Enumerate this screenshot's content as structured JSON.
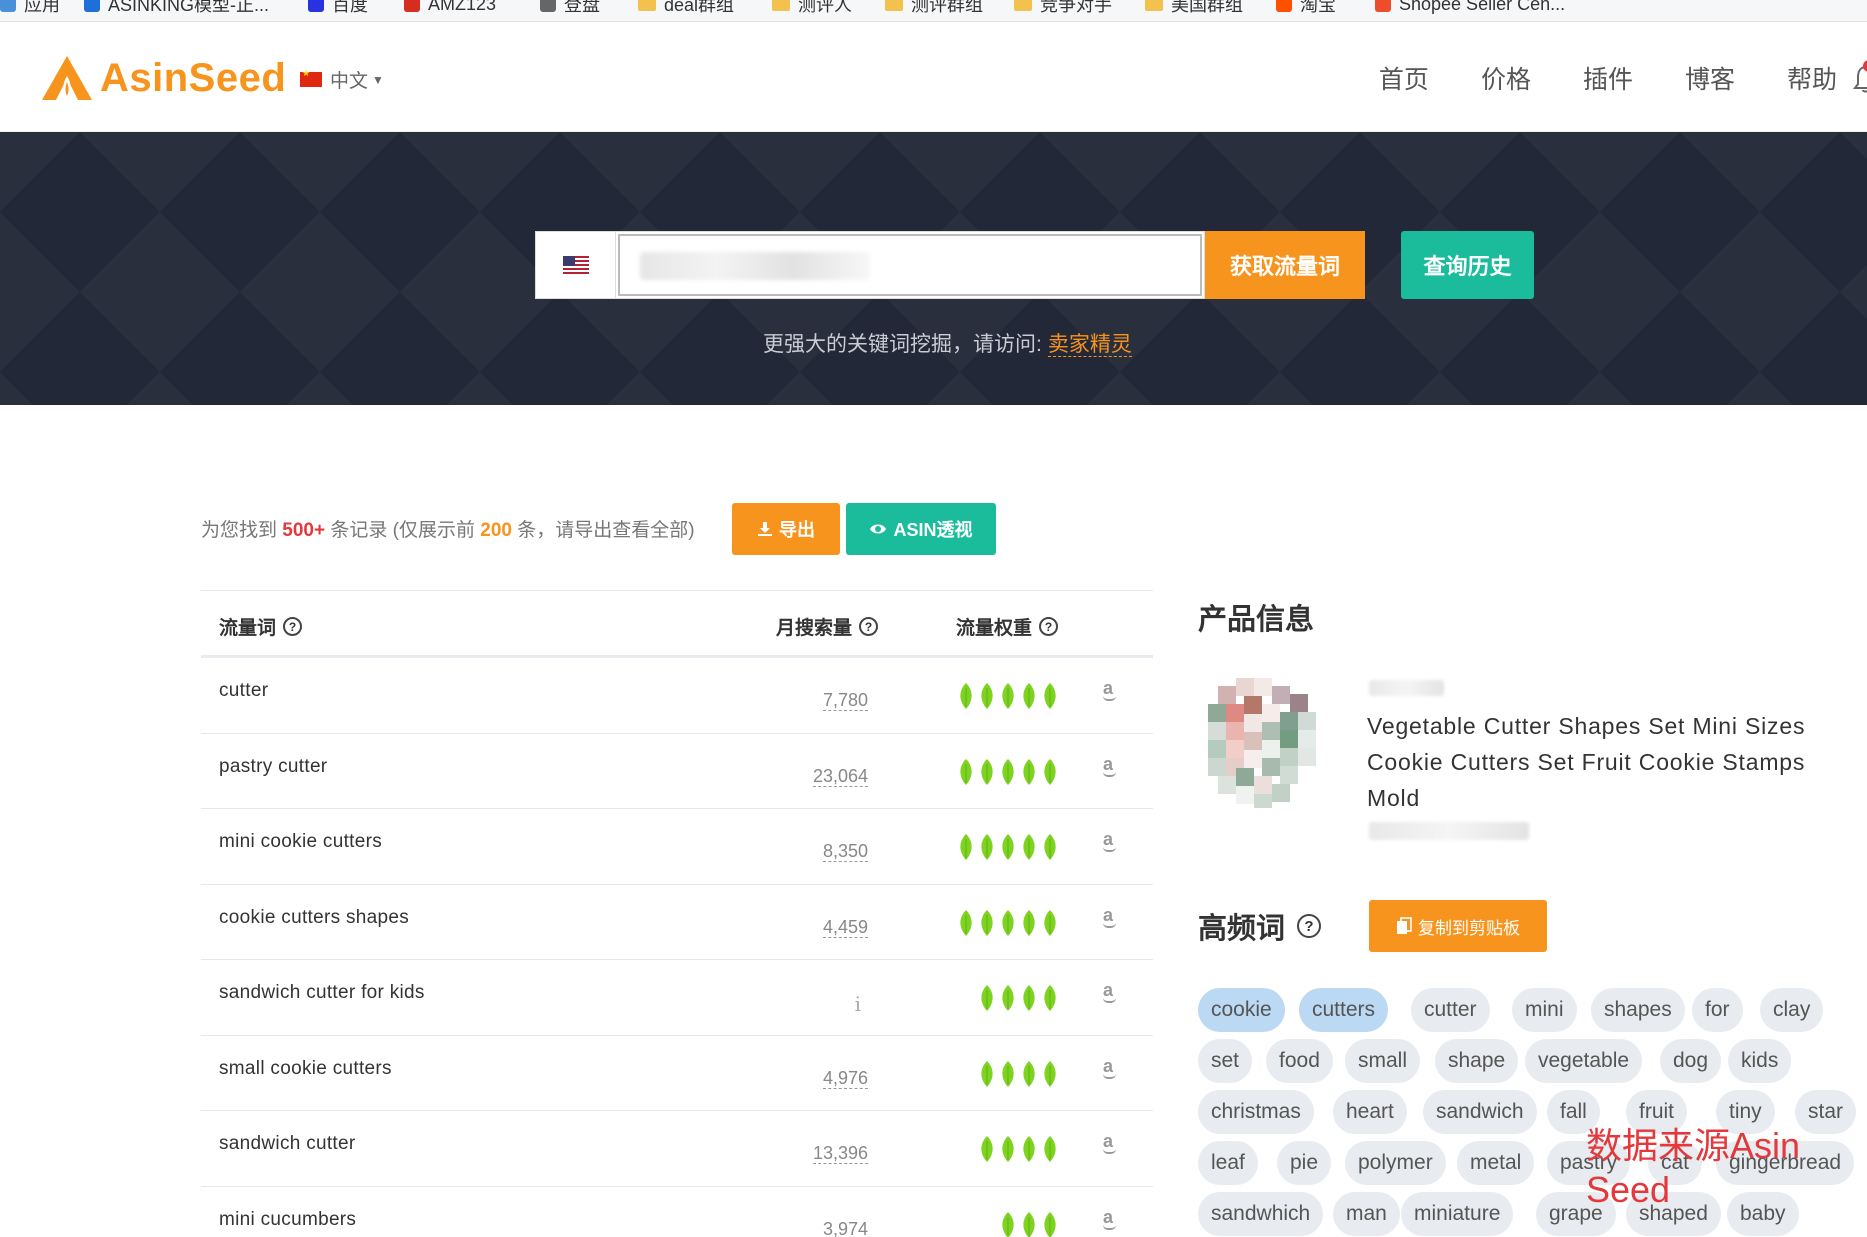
{
  "bookmarks": [
    {
      "label": "应用",
      "color": "#4a90d9"
    },
    {
      "label": "ASINKING模型-正...",
      "color": "#1e6fd9"
    },
    {
      "label": "百度",
      "color": "#2932e1"
    },
    {
      "label": "AMZ123",
      "color": "#d62d20"
    },
    {
      "label": "登盘",
      "color": "#666666"
    },
    {
      "label": "deal群组",
      "color": "#f2c14e"
    },
    {
      "label": "测评人",
      "color": "#f2c14e"
    },
    {
      "label": "测评群组",
      "color": "#f2c14e"
    },
    {
      "label": "竞争对手",
      "color": "#f2c14e"
    },
    {
      "label": "美国群组",
      "color": "#f2c14e"
    },
    {
      "label": "淘宝",
      "color": "#ff5000"
    },
    {
      "label": "Shopee Seller Cen...",
      "color": "#ee4d2d"
    }
  ],
  "header": {
    "brand": "AsinSeed",
    "lang": "中文",
    "nav": [
      "首页",
      "价格",
      "插件",
      "博客",
      "帮助"
    ]
  },
  "search": {
    "country": "US",
    "value": "",
    "get_btn": "获取流量词",
    "history_btn": "查询历史",
    "note_prefix": "更强大的关键词挖掘，请访问:",
    "note_link": "卖家精灵"
  },
  "summary": {
    "prefix": "为您找到",
    "count": "500+",
    "middle": "条记录 (仅展示前",
    "shown": "200",
    "suffix": "条，请导出查看全部)",
    "export_btn": "导出",
    "asin_btn": "ASIN透视"
  },
  "table": {
    "headers": {
      "keyword": "流量词",
      "volume": "月搜索量",
      "weight": "流量权重"
    },
    "rows": [
      {
        "keyword": "cutter",
        "volume": "7,780",
        "leaves": 5
      },
      {
        "keyword": "pastry cutter",
        "volume": "23,064",
        "leaves": 5
      },
      {
        "keyword": "mini cookie cutters",
        "volume": "8,350",
        "leaves": 5
      },
      {
        "keyword": "cookie cutters shapes",
        "volume": "4,459",
        "leaves": 5
      },
      {
        "keyword": "sandwich cutter for kids",
        "volume": "",
        "leaves": 4
      },
      {
        "keyword": "small cookie cutters",
        "volume": "4,976",
        "leaves": 4
      },
      {
        "keyword": "sandwich cutter",
        "volume": "13,396",
        "leaves": 4
      },
      {
        "keyword": "mini cucumbers",
        "volume": "3,974",
        "leaves": 3
      }
    ]
  },
  "product": {
    "section_title": "产品信息",
    "title": "Vegetable Cutter Shapes Set Mini Sizes Cookie Cutters Set Fruit Cookie Stamps Mold"
  },
  "keywords": {
    "section_title": "高频词",
    "copy_btn": "复制到剪贴板",
    "tags": [
      [
        "cookie",
        "cutters",
        "cutter",
        "mini",
        "shapes",
        "for",
        "clay"
      ],
      [
        "set",
        "food",
        "small",
        "shape",
        "vegetable",
        "dog",
        "kids"
      ],
      [
        "christmas",
        "heart",
        "sandwich",
        "fall",
        "fruit",
        "tiny",
        "star"
      ],
      [
        "leaf",
        "pie",
        "polymer",
        "metal",
        "pastry",
        "cat",
        "gingerbread"
      ],
      [
        "sandwhich",
        "man",
        "miniature",
        "grape",
        "shaped",
        "baby"
      ]
    ],
    "highlighted": [
      "cookie",
      "cutters"
    ]
  },
  "watermark": "数据来源Asin Seed",
  "colors": {
    "orange": "#f7941d",
    "teal": "#1abc9c",
    "hero_bg": "#232838",
    "leaf": "#7ed321"
  }
}
